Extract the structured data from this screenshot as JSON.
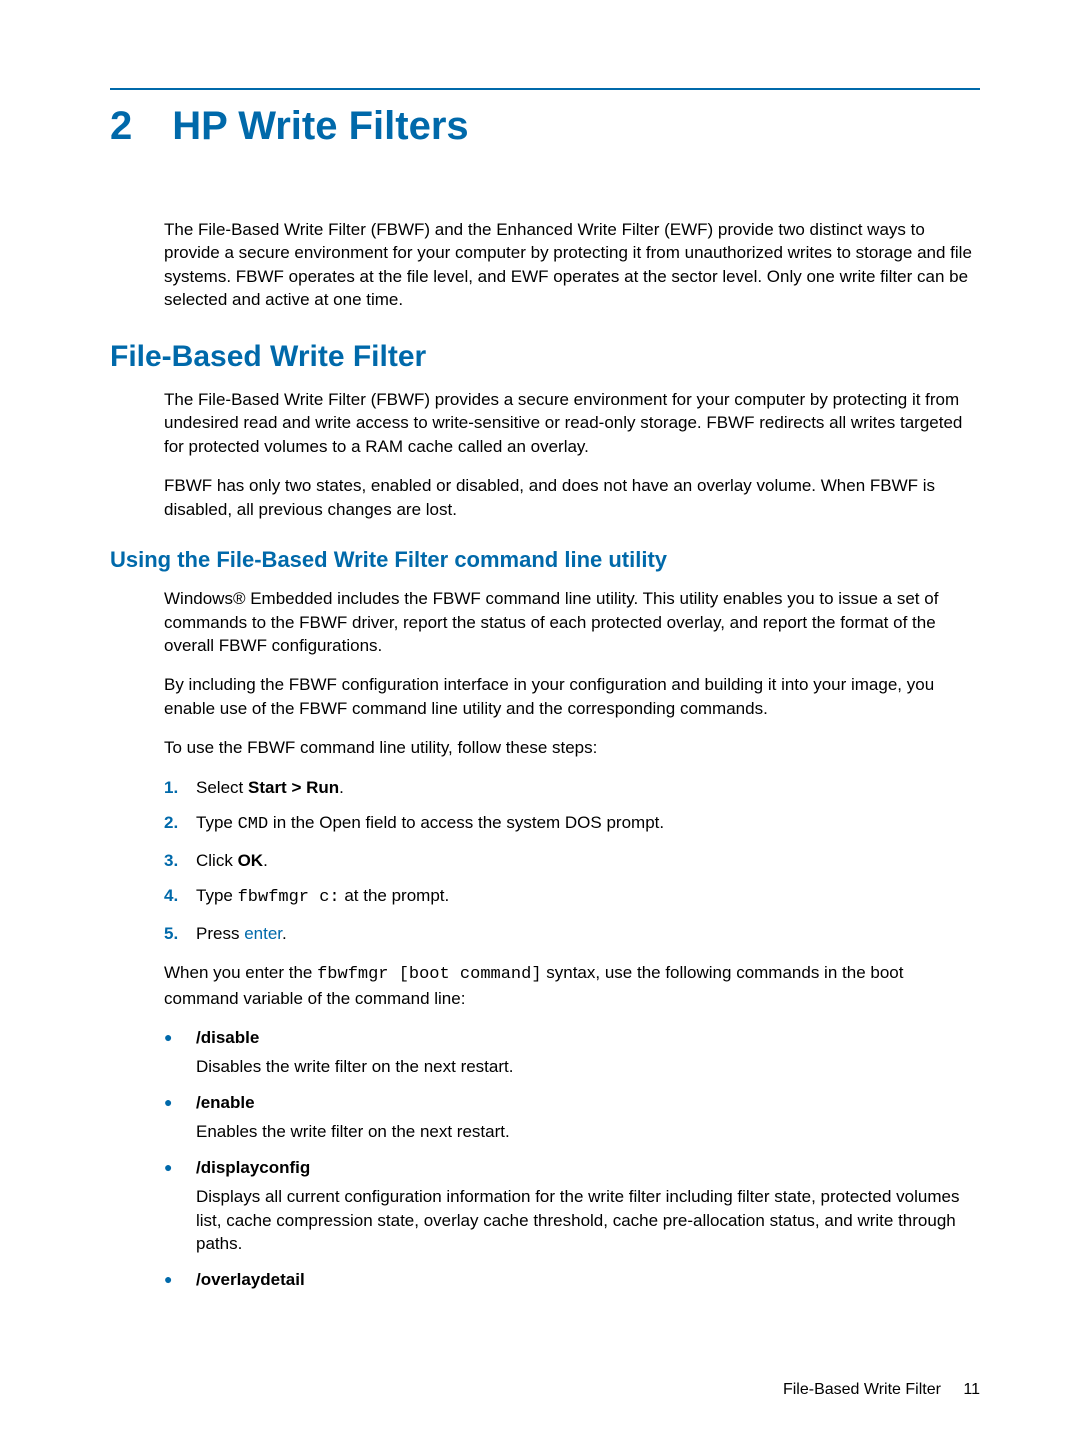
{
  "chapter": {
    "number": "2",
    "title": "HP Write Filters"
  },
  "intro": "The File-Based Write Filter (FBWF) and the Enhanced Write Filter (EWF) provide two distinct ways to provide a secure environment for your computer by protecting it from unauthorized writes to storage and file systems. FBWF operates at the file level, and EWF operates at the sector level. Only one write filter can be selected and active at one time.",
  "section1": {
    "title": "File-Based Write Filter",
    "p1": "The File-Based Write Filter (FBWF) provides a secure environment for your computer by protecting it from undesired read and write access to write-sensitive or read-only storage. FBWF redirects all writes targeted for protected volumes to a RAM cache called an overlay.",
    "p2": "FBWF has only two states, enabled or disabled, and does not have an overlay volume. When FBWF is disabled, all previous changes are lost."
  },
  "section2": {
    "title": "Using the File-Based Write Filter command line utility",
    "p1": "Windows® Embedded includes the FBWF command line utility. This utility enables you to issue a set of commands to the FBWF driver, report the status of each protected overlay, and report the format of the overall FBWF configurations.",
    "p2": "By including the FBWF configuration interface in your configuration and building it into your image, you enable use of the FBWF command line utility and the corresponding commands.",
    "p3": "To use the FBWF command line utility, follow these steps:"
  },
  "steps": {
    "s1": {
      "num": "1.",
      "pre": "Select ",
      "bold": "Start > Run",
      "post": "."
    },
    "s2": {
      "num": "2.",
      "pre": "Type ",
      "code": "CMD",
      "post": " in the Open field to access the system DOS prompt."
    },
    "s3": {
      "num": "3.",
      "pre": "Click ",
      "bold": "OK",
      "post": "."
    },
    "s4": {
      "num": "4.",
      "pre": "Type ",
      "code": "fbwfmgr c:",
      "post": " at the prompt."
    },
    "s5": {
      "num": "5.",
      "pre": "Press ",
      "key": "enter",
      "post": "."
    }
  },
  "afterSteps": {
    "pre": "When you enter the ",
    "code": "fbwfmgr [boot command]",
    "post": " syntax, use the following commands in the boot command variable of the command line:"
  },
  "cmds": {
    "c1": {
      "name": "/disable",
      "desc": "Disables the write filter on the next restart."
    },
    "c2": {
      "name": "/enable",
      "desc": "Enables the write filter on the next restart."
    },
    "c3": {
      "name": "/displayconfig",
      "desc": "Displays all current configuration information for the write filter including filter state, protected volumes list, cache compression state, overlay cache threshold, cache pre-allocation status, and write through paths."
    },
    "c4": {
      "name": "/overlaydetail"
    }
  },
  "footer": {
    "label": "File-Based Write Filter",
    "page": "11"
  }
}
